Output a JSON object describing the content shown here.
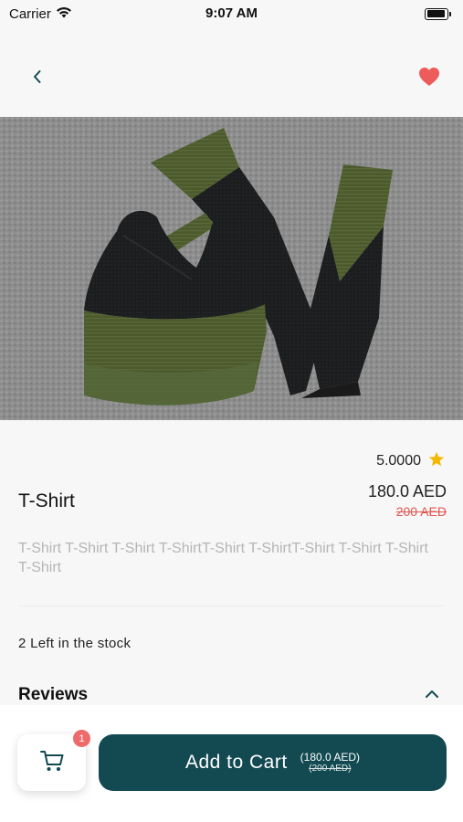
{
  "status": {
    "carrier": "Carrier",
    "time": "9:07 AM"
  },
  "product": {
    "rating": "5.0000",
    "title": "T-Shirt",
    "price": "180.0 AED",
    "old_price": "200 AED",
    "description": "T-Shirt T-Shirt T-Shirt T-ShirtT-Shirt T-ShirtT-Shirt T-Shirt T-Shirt T-Shirt",
    "stock": "2 Left in the stock"
  },
  "reviews": {
    "title": "Reviews"
  },
  "cart": {
    "badge_count": "1"
  },
  "add_to_cart": {
    "label": "Add to Cart",
    "price": "(180.0 AED)",
    "old_price": "(200 AED)"
  },
  "colors": {
    "accent": "#134a52",
    "heart": "#ee5b5b",
    "strike": "#e0564f",
    "star": "#f5b800"
  },
  "icons": [
    "wifi-icon",
    "battery-icon",
    "back-chevron-icon",
    "heart-icon",
    "star-icon",
    "chevron-up-icon",
    "cart-icon"
  ]
}
